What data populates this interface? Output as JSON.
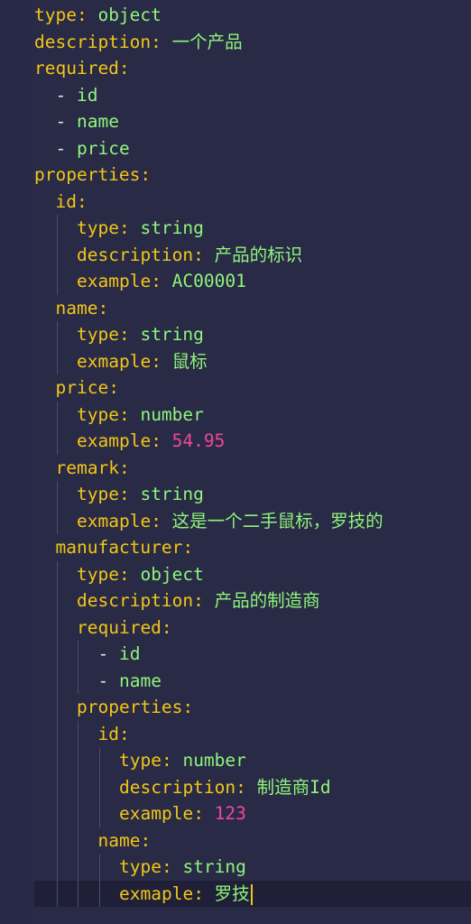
{
  "lines": [
    {
      "indent": 0,
      "key": "type",
      "value": "object",
      "vtype": "str"
    },
    {
      "indent": 0,
      "key": "description",
      "value": "一个产品",
      "vtype": "str"
    },
    {
      "indent": 0,
      "key": "required",
      "value": "",
      "vtype": "none"
    },
    {
      "indent": 1,
      "dash": true,
      "value": "id",
      "vtype": "str"
    },
    {
      "indent": 1,
      "dash": true,
      "value": "name",
      "vtype": "str"
    },
    {
      "indent": 1,
      "dash": true,
      "value": "price",
      "vtype": "str"
    },
    {
      "indent": 0,
      "key": "properties",
      "value": "",
      "vtype": "none"
    },
    {
      "indent": 1,
      "key": "id",
      "value": "",
      "vtype": "none"
    },
    {
      "indent": 2,
      "key": "type",
      "value": "string",
      "vtype": "str"
    },
    {
      "indent": 2,
      "key": "description",
      "value": "产品的标识",
      "vtype": "str"
    },
    {
      "indent": 2,
      "key": "example",
      "value": "AC00001",
      "vtype": "str"
    },
    {
      "indent": 1,
      "key": "name",
      "value": "",
      "vtype": "none"
    },
    {
      "indent": 2,
      "key": "type",
      "value": "string",
      "vtype": "str"
    },
    {
      "indent": 2,
      "key": "exmaple",
      "value": "鼠标",
      "vtype": "str"
    },
    {
      "indent": 1,
      "key": "price",
      "value": "",
      "vtype": "none"
    },
    {
      "indent": 2,
      "key": "type",
      "value": "number",
      "vtype": "str"
    },
    {
      "indent": 2,
      "key": "example",
      "value": "54.95",
      "vtype": "num"
    },
    {
      "indent": 1,
      "key": "remark",
      "value": "",
      "vtype": "none"
    },
    {
      "indent": 2,
      "key": "type",
      "value": "string",
      "vtype": "str"
    },
    {
      "indent": 2,
      "key": "exmaple",
      "value": "这是一个二手鼠标，罗技的",
      "vtype": "str"
    },
    {
      "indent": 1,
      "key": "manufacturer",
      "value": "",
      "vtype": "none"
    },
    {
      "indent": 2,
      "key": "type",
      "value": "object",
      "vtype": "str"
    },
    {
      "indent": 2,
      "key": "description",
      "value": "产品的制造商",
      "vtype": "str"
    },
    {
      "indent": 2,
      "key": "required",
      "value": "",
      "vtype": "none"
    },
    {
      "indent": 3,
      "dash": true,
      "value": "id",
      "vtype": "str"
    },
    {
      "indent": 3,
      "dash": true,
      "value": "name",
      "vtype": "str"
    },
    {
      "indent": 2,
      "key": "properties",
      "value": "",
      "vtype": "none"
    },
    {
      "indent": 3,
      "key": "id",
      "value": "",
      "vtype": "none"
    },
    {
      "indent": 4,
      "key": "type",
      "value": "number",
      "vtype": "str"
    },
    {
      "indent": 4,
      "key": "description",
      "value": "制造商Id",
      "vtype": "str"
    },
    {
      "indent": 4,
      "key": "example",
      "value": "123",
      "vtype": "num"
    },
    {
      "indent": 3,
      "key": "name",
      "value": "",
      "vtype": "none"
    },
    {
      "indent": 4,
      "key": "type",
      "value": "string",
      "vtype": "str"
    },
    {
      "indent": 4,
      "key": "exmaple",
      "value": "罗技",
      "vtype": "str",
      "active": true
    }
  ],
  "colors": {
    "background": "#292a45",
    "key": "#f2c618",
    "string_value": "#8ff57c",
    "number_value": "#f2479a"
  }
}
